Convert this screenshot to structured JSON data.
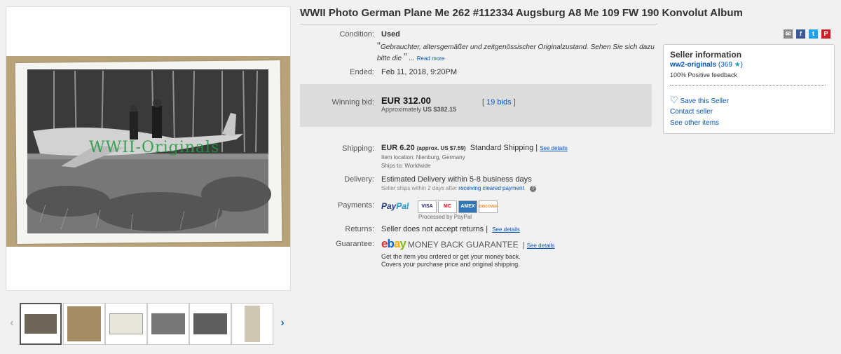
{
  "title": "WWII Photo German Plane Me 262 #112334 Augsburg A8 Me 109 FW 190 Konvolut Album",
  "gallery": {
    "watermark": "WWII-Originals",
    "thumbnail_count": 6,
    "selected_thumbnail": 1
  },
  "condition": {
    "label": "Condition:",
    "value": "Used",
    "description": "Gebrauchter, altersgemäßer und zeitgenössischer Originalzustand. Sehen Sie sich dazu bitte die",
    "open_quote": "“",
    "close_quote": "”",
    "ellipsis": "...",
    "read_more": "Read more"
  },
  "ended": {
    "label": "Ended:",
    "value": "Feb 11, 2018, 9:20PM"
  },
  "bid": {
    "label": "Winning bid:",
    "price": "EUR 312.00",
    "approx_label": "Approximately",
    "approx_value": "US $382.15",
    "bids": "19 bids",
    "bracket_open": "[",
    "bracket_close": "]"
  },
  "shipping": {
    "label": "Shipping:",
    "cost": "EUR 6.20",
    "approx": "(approx. US $7.59)",
    "method": "Standard Shipping",
    "sep": "|",
    "see_details": "See details",
    "item_location": "Item location:  Nienburg, Germany",
    "ships_to": "Ships to:  Worldwide"
  },
  "delivery": {
    "label": "Delivery:",
    "estimate": "Estimated Delivery within 5-8 business days",
    "note_prefix": "Seller ships within 2 days after",
    "note_link": "receiving cleared payment",
    "note_suffix": "."
  },
  "payments": {
    "label": "Payments:",
    "paypal_1": "Pay",
    "paypal_2": "Pal",
    "cards": [
      "VISA",
      "MC",
      "AMEX",
      "DISCOVER"
    ],
    "processed": "Processed by PayPal"
  },
  "returns": {
    "label": "Returns:",
    "value": "Seller does not accept returns",
    "sep": "|",
    "see_details": "See details"
  },
  "guarantee": {
    "label": "Guarantee:",
    "logo": [
      "e",
      "b",
      "a",
      "y"
    ],
    "title": "MONEY BACK GUARANTEE",
    "sep": "|",
    "see_details": "See details",
    "line1": "Get the item you ordered or get your money back.",
    "line2": "Covers your purchase price and original shipping."
  },
  "share": {
    "icons": [
      "email-icon",
      "facebook-icon",
      "twitter-icon",
      "pinterest-icon"
    ],
    "colors": [
      "#888888",
      "#3b5998",
      "#1da1f2",
      "#cb2027"
    ]
  },
  "seller": {
    "heading": "Seller information",
    "name": "ww2-originals",
    "score": "(369",
    "score_close": ")",
    "feedback": "100% Positive feedback",
    "save": "Save this Seller",
    "contact": "Contact seller",
    "other": "See other items"
  },
  "colors": {
    "link": "#0654ba",
    "star": "#1aa3b5",
    "bid_box": "#dcdcdc"
  }
}
